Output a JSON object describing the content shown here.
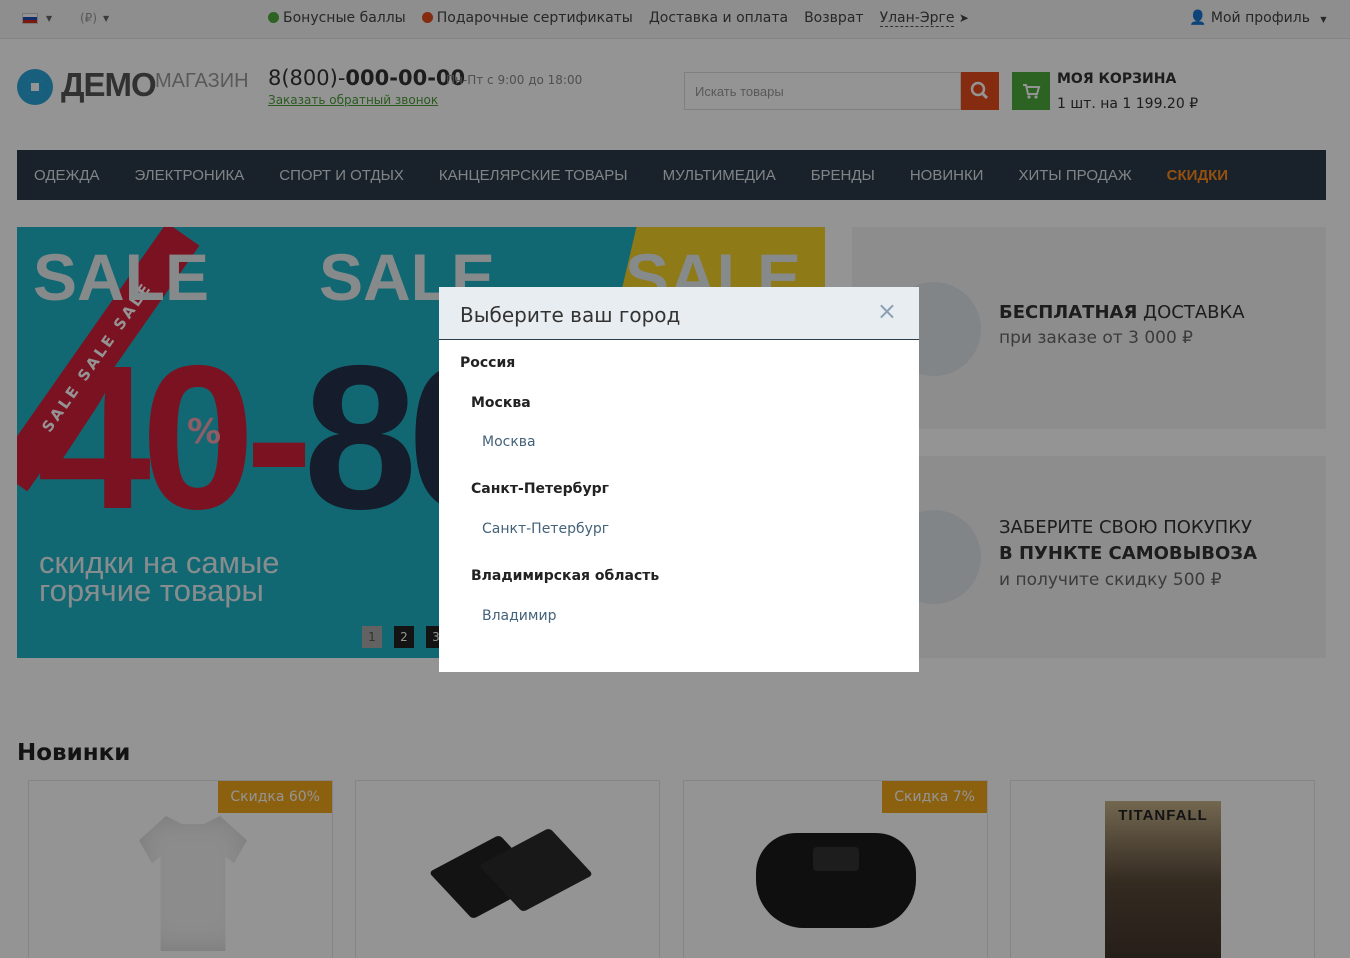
{
  "topbar": {
    "currency": "(₽)",
    "bonus": "Бонусные баллы",
    "gift": "Подарочные сертификаты",
    "delivery": "Доставка и оплата",
    "returns": "Возврат",
    "city": "Улан-Эрге",
    "profile": "Мой профиль"
  },
  "header": {
    "logo_main": "ДЕМО",
    "logo_sub": "МАГАЗИН",
    "phone_prefix": "8(800)-",
    "phone_main": "000-00-00",
    "hours": "Пн-Пт с 9:00 до 18:00",
    "callback": "Заказать обратный звонок",
    "search_placeholder": "Искать товары",
    "cart_title": "МОЯ КОРЗИНА",
    "cart_summary": "1 шт. на 1 199.20 ₽"
  },
  "menu": [
    "ОДЕЖДА",
    "ЭЛЕКТРОНИКА",
    "СПОРТ И ОТДЫХ",
    "КАНЦЕЛЯРСКИЕ ТОВАРЫ",
    "МУЛЬТИМЕДИА",
    "БРЕНДЫ",
    "НОВИНКИ",
    "ХИТЫ ПРОДАЖ",
    "СКИДКИ"
  ],
  "banner": {
    "sale_word": "SALE",
    "ribbon": "SALE SALE SALE",
    "big_left": "40-",
    "big_right": "80",
    "percent": "%",
    "tagline_1": "скидки на самые",
    "tagline_2": "горячие товары",
    "dots": [
      "1",
      "2",
      "3"
    ]
  },
  "promo": {
    "delivery_bold": "БЕСПЛАТНАЯ",
    "delivery_rest": " ДОСТАВКА",
    "delivery_sub": "при заказе от 3 000 ₽",
    "pickup_line1": "ЗАБЕРИТЕ СВОЮ ПОКУПКУ",
    "pickup_line2": "В ПУНКТЕ САМОВЫВОЗА",
    "pickup_sub": "и получите скидку 500 ₽"
  },
  "new_section": {
    "title": "Новинки",
    "badge_1": "Скидка 60%",
    "badge_3": "Скидка 7%",
    "poster_title": "TITANFALL"
  },
  "modal": {
    "title": "Выберите ваш город",
    "close": "×",
    "country": "Россия",
    "regions": [
      {
        "name": "Москва",
        "city": "Москва"
      },
      {
        "name": "Санкт-Петербург",
        "city": "Санкт-Петербург"
      },
      {
        "name": "Владимирская область",
        "city": "Владимир"
      }
    ]
  },
  "colors": {
    "accent_orange": "#e34a1c",
    "accent_green": "#4ca93c",
    "menu_bg": "#2b3c4a",
    "sale_highlight": "#ff8a1a",
    "badge": "#f0a81c"
  }
}
